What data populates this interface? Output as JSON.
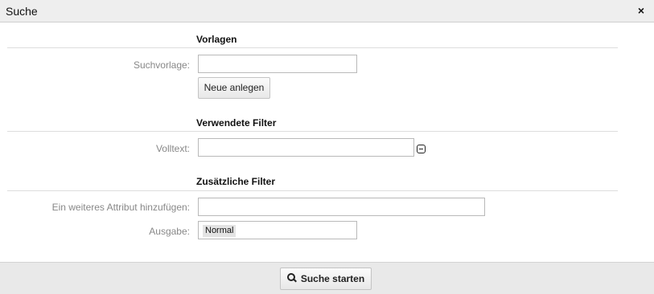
{
  "dialog": {
    "title": "Suche",
    "close_symbol": "×"
  },
  "sections": {
    "templates": {
      "heading": "Vorlagen",
      "template_label": "Suchvorlage:",
      "template_value": "",
      "create_button": "Neue anlegen"
    },
    "used_filters": {
      "heading": "Verwendete Filter",
      "fulltext_label": "Volltext:",
      "fulltext_value": "",
      "remove_icon": "minus-square-icon"
    },
    "additional_filters": {
      "heading": "Zusätzliche Filter",
      "add_attribute_label": "Ein weiteres Attribut hinzufügen:",
      "add_attribute_value": "",
      "output_label": "Ausgabe:",
      "output_value": "Normal"
    }
  },
  "footer": {
    "search_button": "Suche starten",
    "search_icon": "search-icon"
  },
  "colors": {
    "titlebar_bg": "#eeeeee",
    "footer_bg": "#e9e9e9",
    "label_text": "#888888",
    "divider": "#dddddd"
  }
}
